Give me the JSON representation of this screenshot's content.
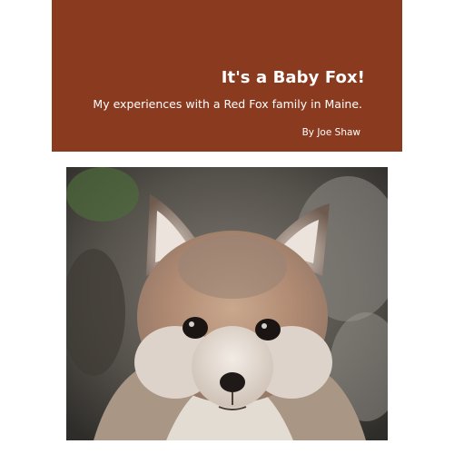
{
  "book": {
    "title": "It's a Baby Fox!",
    "subtitle": "My experiences with a Red Fox family in Maine.",
    "author": "By Joe Shaw",
    "banner_color": "#8a3a1f"
  },
  "cover_photo": {
    "subject": "red fox kit face"
  }
}
